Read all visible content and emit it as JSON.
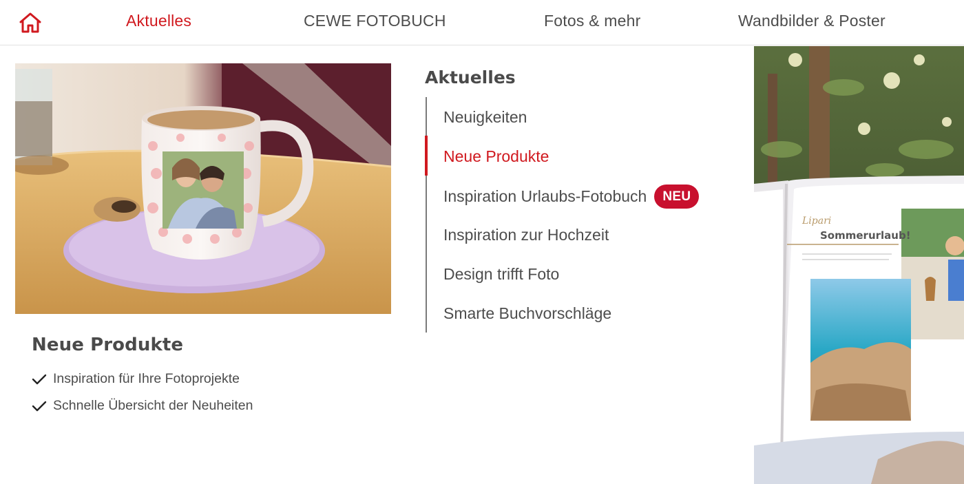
{
  "nav": {
    "items": [
      {
        "label": "Aktuelles",
        "active": true
      },
      {
        "label": "CEWE FOTOBUCH",
        "active": false
      },
      {
        "label": "Fotos & mehr",
        "active": false
      },
      {
        "label": "Wandbilder & Poster",
        "active": false
      }
    ],
    "home_icon": "home-icon"
  },
  "feature": {
    "title": "Neue Produkte",
    "bullets": [
      "Inspiration für Ihre Fotoprojekte",
      "Schnelle Übersicht der Neuheiten"
    ]
  },
  "submenu": {
    "title": "Aktuelles",
    "items": [
      {
        "label": "Neuigkeiten"
      },
      {
        "label": "Neue Produkte",
        "active": true
      },
      {
        "label": "Inspiration Urlaubs-Fotobuch",
        "badge": "NEU"
      },
      {
        "label": "Inspiration zur Hochzeit"
      },
      {
        "label": "Design trifft Foto"
      },
      {
        "label": "Smarte Buchvorschläge"
      }
    ]
  },
  "photobook": {
    "headline": "Sommerurlaub!",
    "script": "Lipari"
  },
  "colors": {
    "accent": "#d0191f",
    "badge": "#c8102e",
    "text": "#4a4a4a"
  }
}
